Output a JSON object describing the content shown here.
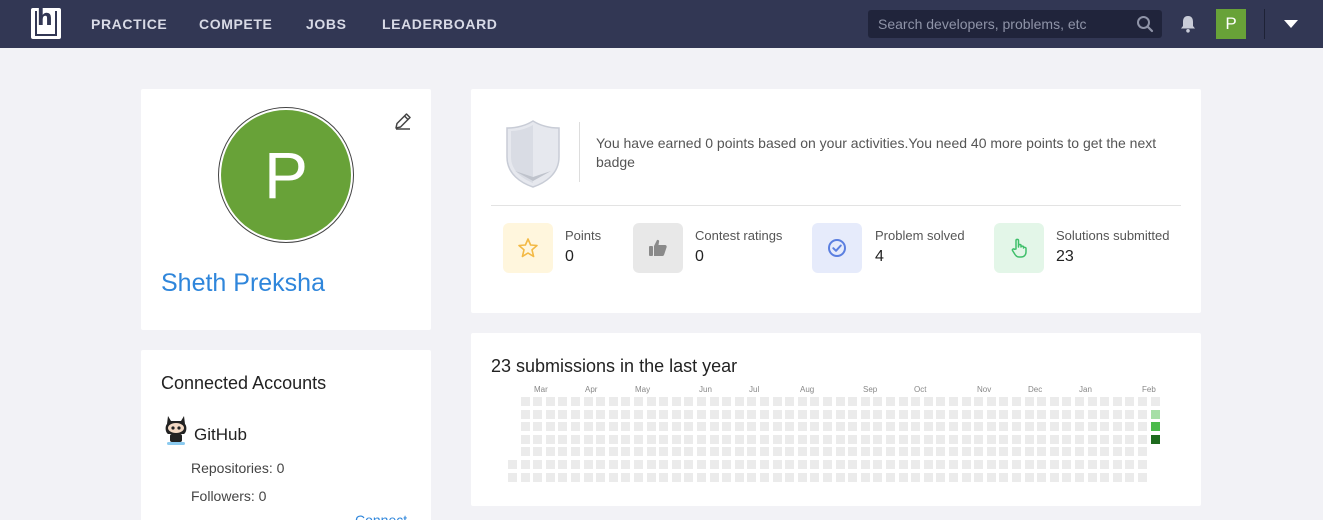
{
  "nav": {
    "logo_letter": "h",
    "links": [
      "PRACTICE",
      "COMPETE",
      "JOBS",
      "LEADERBOARD"
    ],
    "search_placeholder": "Search developers, problems, etc",
    "avatar_letter": "P"
  },
  "profile": {
    "avatar_letter": "P",
    "name": "Sheth Preksha"
  },
  "accounts": {
    "title": "Connected Accounts",
    "github_label": "GitHub",
    "repositories": "Repositories: 0",
    "followers": "Followers: 0",
    "connect": "Connect"
  },
  "badge": {
    "text": "You have earned 0 points based on your activities.You need 40 more points to get the next badge",
    "stats": [
      {
        "label": "Points",
        "value": "0",
        "icon": "star-icon",
        "bg": "#fff6dd",
        "color": "#f3b944"
      },
      {
        "label": "Contest ratings",
        "value": "0",
        "icon": "thumbs-up-icon",
        "bg": "#e8e8e8",
        "color": "#8a8a8a"
      },
      {
        "label": "Problem solved",
        "value": "4",
        "icon": "check-circle-icon",
        "bg": "#e6ebfb",
        "color": "#5b7fe0"
      },
      {
        "label": "Solutions submitted",
        "value": "23",
        "icon": "pointer-hand-icon",
        "bg": "#e3f6e8",
        "color": "#3fbf6a"
      }
    ]
  },
  "submissions": {
    "title": "23 submissions in the last year",
    "months": [
      "Mar",
      "Apr",
      "May",
      "Jun",
      "Jul",
      "Aug",
      "Sep",
      "Oct",
      "Nov",
      "Dec",
      "Jan",
      "Feb"
    ],
    "empty_color": "#ebebeb",
    "active_cells": [
      {
        "week": 51,
        "day": 1,
        "color": "#a6dfa6"
      },
      {
        "week": 51,
        "day": 2,
        "color": "#4cbb4c"
      },
      {
        "week": 51,
        "day": 3,
        "color": "#1e6b1e"
      }
    ]
  }
}
